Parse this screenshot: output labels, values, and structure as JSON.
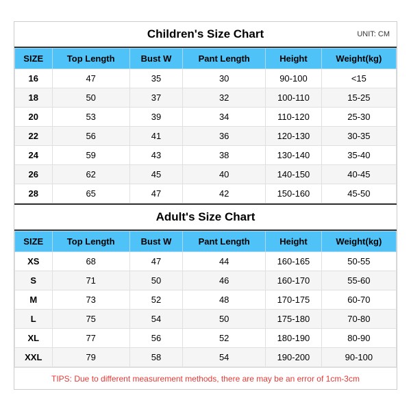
{
  "children_chart": {
    "title": "Children's Size Chart",
    "unit": "UNIT: CM",
    "headers": [
      "SIZE",
      "Top Length",
      "Bust W",
      "Pant Length",
      "Height",
      "Weight(kg)"
    ],
    "rows": [
      [
        "16",
        "47",
        "35",
        "30",
        "90-100",
        "<15"
      ],
      [
        "18",
        "50",
        "37",
        "32",
        "100-110",
        "15-25"
      ],
      [
        "20",
        "53",
        "39",
        "34",
        "110-120",
        "25-30"
      ],
      [
        "22",
        "56",
        "41",
        "36",
        "120-130",
        "30-35"
      ],
      [
        "24",
        "59",
        "43",
        "38",
        "130-140",
        "35-40"
      ],
      [
        "26",
        "62",
        "45",
        "40",
        "140-150",
        "40-45"
      ],
      [
        "28",
        "65",
        "47",
        "42",
        "150-160",
        "45-50"
      ]
    ]
  },
  "adult_chart": {
    "title": "Adult's Size Chart",
    "headers": [
      "SIZE",
      "Top Length",
      "Bust W",
      "Pant Length",
      "Height",
      "Weight(kg)"
    ],
    "rows": [
      [
        "XS",
        "68",
        "47",
        "44",
        "160-165",
        "50-55"
      ],
      [
        "S",
        "71",
        "50",
        "46",
        "160-170",
        "55-60"
      ],
      [
        "M",
        "73",
        "52",
        "48",
        "170-175",
        "60-70"
      ],
      [
        "L",
        "75",
        "54",
        "50",
        "175-180",
        "70-80"
      ],
      [
        "XL",
        "77",
        "56",
        "52",
        "180-190",
        "80-90"
      ],
      [
        "XXL",
        "79",
        "58",
        "54",
        "190-200",
        "90-100"
      ]
    ]
  },
  "tips": "TIPS: Due to different measurement methods, there are may be an error of 1cm-3cm"
}
